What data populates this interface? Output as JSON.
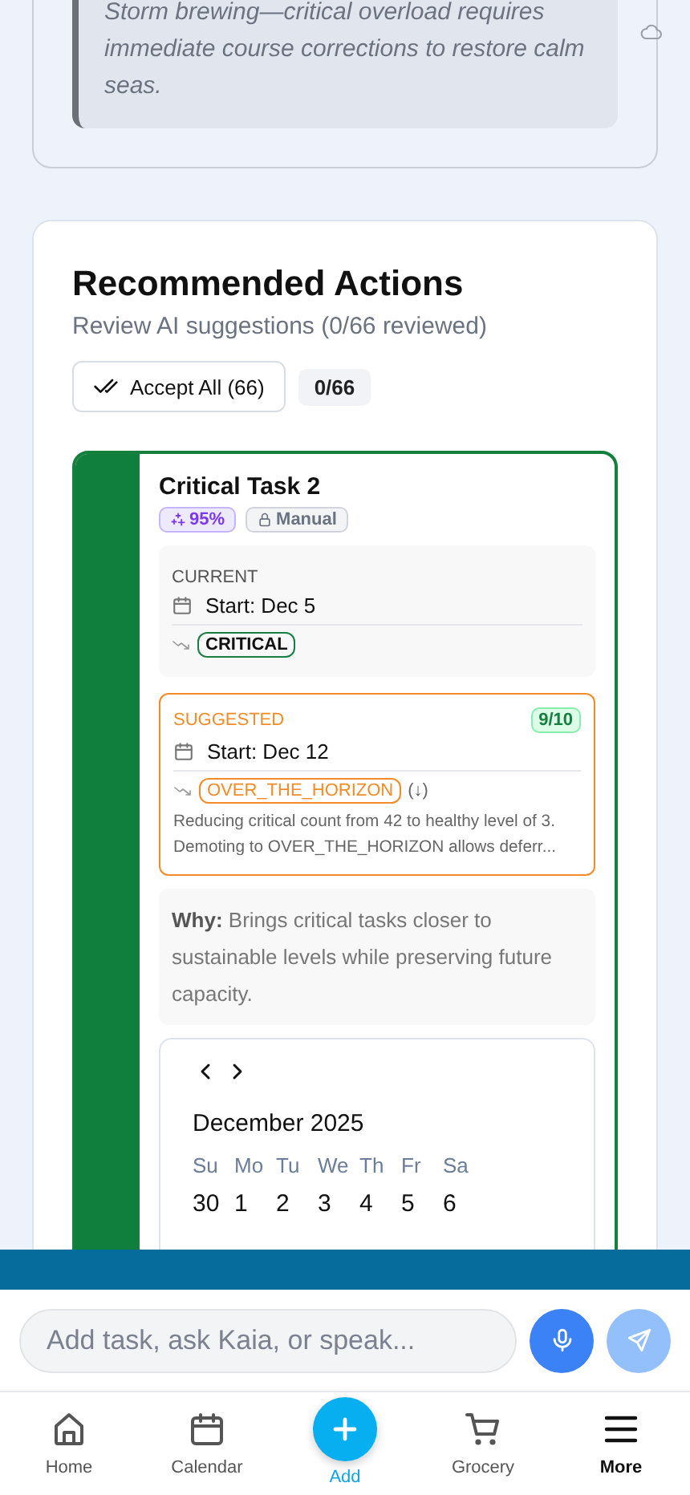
{
  "insight": {
    "quote": "Storm brewing—critical overload requires immediate course corrections to restore calm seas."
  },
  "recommended": {
    "title": "Recommended Actions",
    "subtitle": "Review AI suggestions (0/66 reviewed)",
    "accept_button": "Accept All (66)",
    "progress": "0/66"
  },
  "task": {
    "title": "Critical Task 2",
    "confidence": "95%",
    "mode": "Manual",
    "current": {
      "label": "CURRENT",
      "start": "Start: Dec 5",
      "priority": "CRITICAL"
    },
    "suggested": {
      "label": "SUGGESTED",
      "score": "9/10",
      "start": "Start: Dec 12",
      "priority": "OVER_THE_HORIZON",
      "direction": "(↓)",
      "reason": "Reducing critical count from 42 to healthy level of 3. Demoting to OVER_THE_HORIZON allows deferr..."
    },
    "why_label": "Why:",
    "why": "Brings critical tasks closer to sustainable levels while preserving future capacity.",
    "calendar": {
      "month": "December 2025",
      "weekdays": [
        "Su",
        "Mo",
        "Tu",
        "We",
        "Th",
        "Fr",
        "Sa"
      ],
      "days": [
        "30",
        "1",
        "2",
        "3",
        "4",
        "5",
        "6"
      ]
    }
  },
  "composer": {
    "placeholder": "Add task, ask Kaia, or speak..."
  },
  "nav": [
    {
      "label": "Home",
      "kind": "home",
      "selected": false
    },
    {
      "label": "Calendar",
      "kind": "calendar",
      "selected": false
    },
    {
      "label": "Add",
      "kind": "add",
      "selected": false
    },
    {
      "label": "Grocery",
      "kind": "cart",
      "selected": false
    },
    {
      "label": "More",
      "kind": "menu",
      "selected": true
    }
  ]
}
